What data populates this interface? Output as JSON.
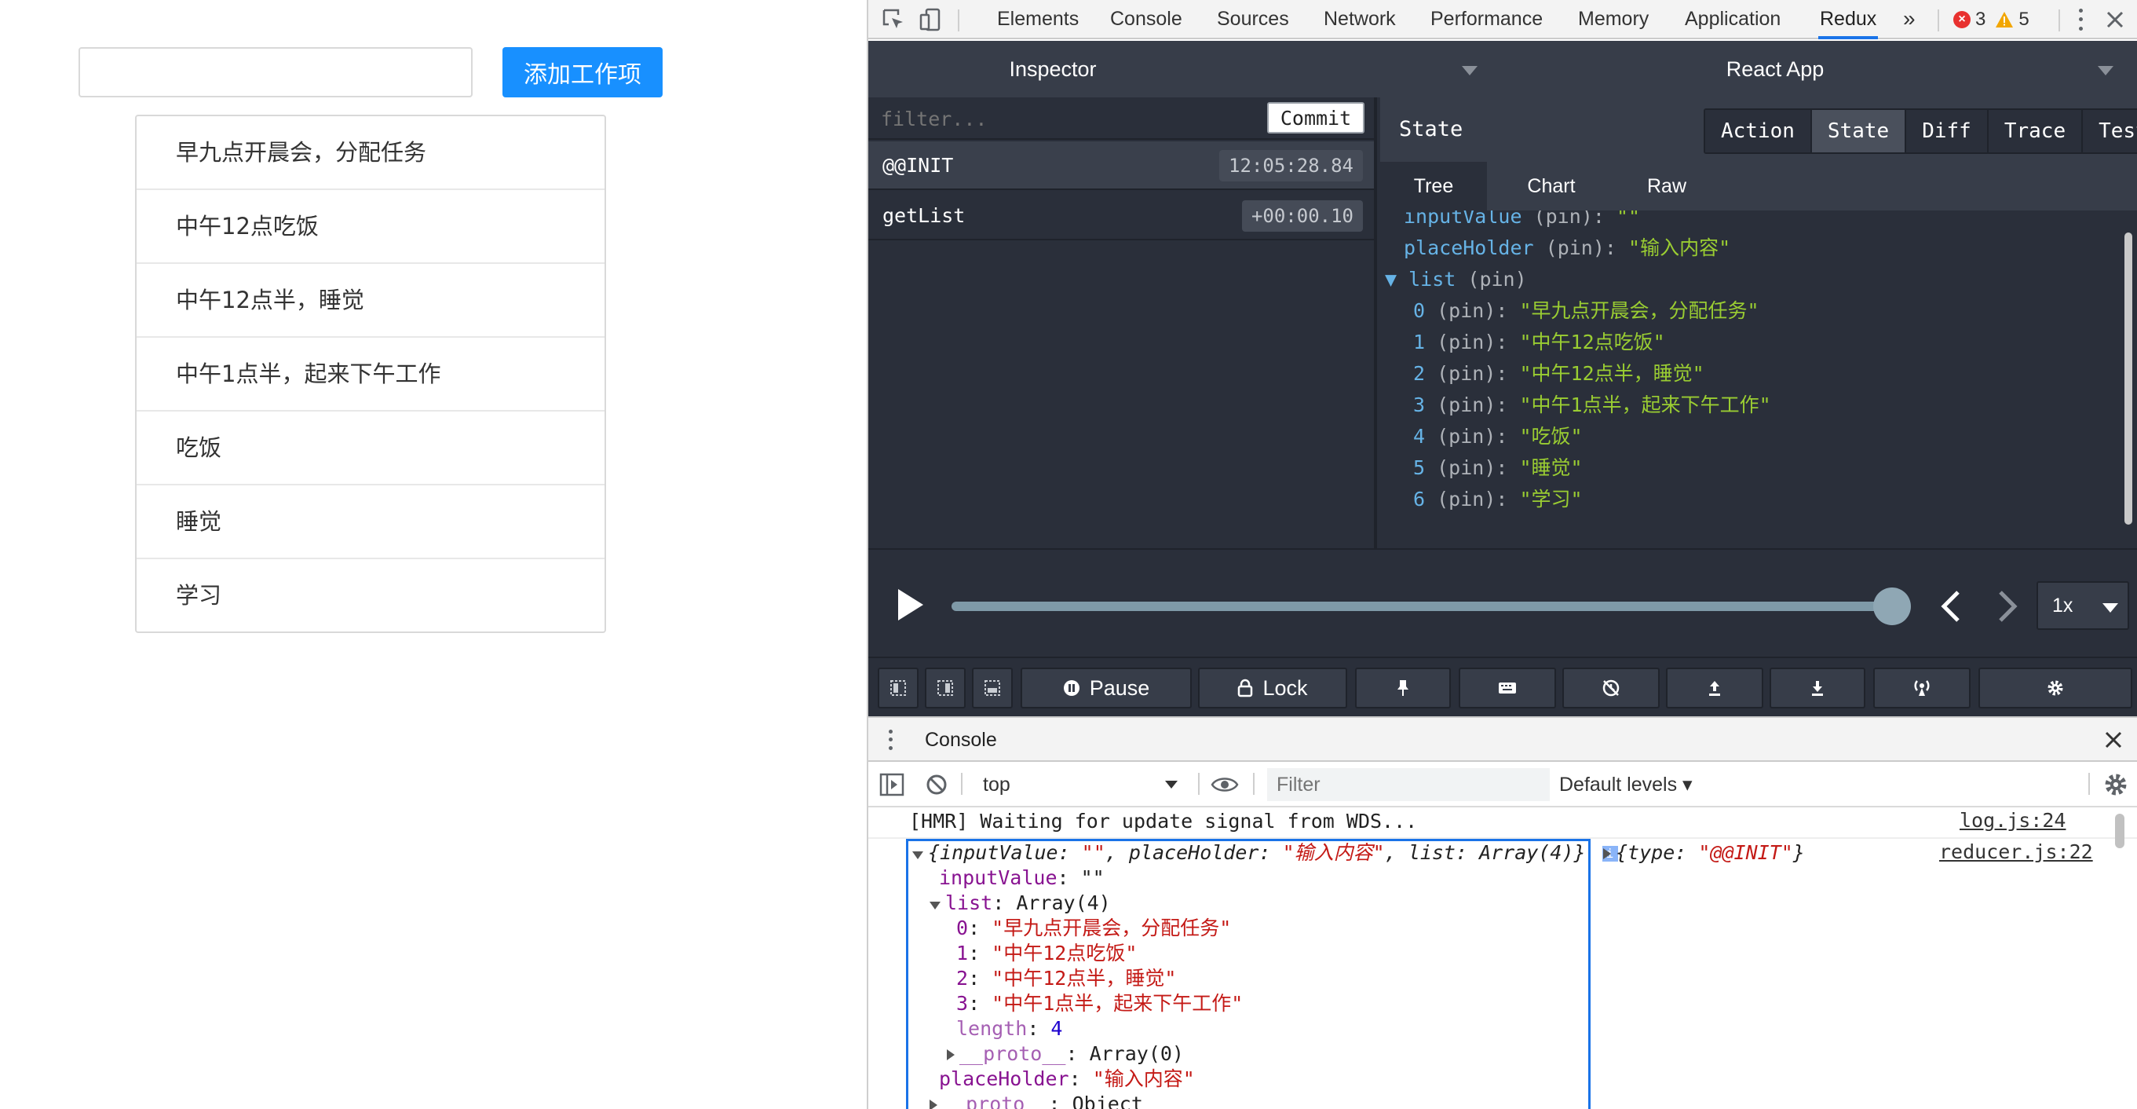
{
  "app": {
    "input_value": "",
    "add_button": "添加工作项",
    "items": [
      "早九点开晨会，分配任务",
      "中午12点吃饭",
      "中午12点半，睡觉",
      "中午1点半，起来下午工作",
      "吃饭",
      "睡觉",
      "学习"
    ]
  },
  "devtools": {
    "tabs": [
      "Elements",
      "Console",
      "Sources",
      "Network",
      "Performance",
      "Memory",
      "Application",
      "Redux"
    ],
    "active_tab": "Redux",
    "more_tabs": "»",
    "errors_count": "3",
    "warnings_count": "5",
    "redux": {
      "inspector_label": "Inspector",
      "instance_label": "React App",
      "filter_placeholder": "filter...",
      "commit_label": "Commit",
      "actions": [
        {
          "name": "@@INIT",
          "time": "12:05:28.84"
        },
        {
          "name": "getList",
          "time": "+00:00.10"
        }
      ],
      "state_label": "State",
      "modes": [
        "Action",
        "State",
        "Diff",
        "Trace",
        "Test"
      ],
      "active_mode": "State",
      "subtabs": [
        "Tree",
        "Chart",
        "Raw"
      ],
      "active_subtab": "Tree",
      "tree": {
        "input_value_key": "inputValue",
        "input_value_val": "\"\"",
        "placeholder_key": "placeHolder",
        "placeholder_val": "\"输入内容\"",
        "list_key": "list",
        "pin": "(pin)",
        "list_items": [
          "\"早九点开晨会，分配任务\"",
          "\"中午12点吃饭\"",
          "\"中午12点半，睡觉\"",
          "\"中午1点半，起来下午工作\"",
          "\"吃饭\"",
          "\"睡觉\"",
          "\"学习\""
        ]
      },
      "speed": "1x",
      "bottom_buttons": {
        "pause": "Pause",
        "lock": "Lock"
      },
      "slider_progress": 1.0
    },
    "console": {
      "tab_label": "Console",
      "context": "top",
      "filter_placeholder": "Filter",
      "levels": "Default levels ▾",
      "hmr_message": "[HMR] Waiting for update signal from WDS...",
      "log_link": "log.js:24",
      "reducer_link": "reducer.js:22",
      "obj_summary_prefix": "{inputValue: ",
      "obj_summary_ph": ", placeHolder: ",
      "obj_summary_ph_val": "\"输入内容\"",
      "obj_summary_list": ", list: Array(4)}",
      "empty_str": "\"\"",
      "input_value_key": "inputValue",
      "list_key": "list",
      "list_type": "Array(4)",
      "list_items": [
        "\"早九点开晨会，分配任务\"",
        "\"中午12点吃饭\"",
        "\"中午12点半，睡觉\"",
        "\"中午1点半，起来下午工作\""
      ],
      "length_key": "length",
      "length_val": "4",
      "proto_key": "__proto__",
      "proto_array": "Array(0)",
      "placeholder_key": "placeHolder",
      "placeholder_val": "\"输入内容\"",
      "proto_object": "Object",
      "action_summary_prefix": "{type: ",
      "action_type": "\"@@INIT\"",
      "action_summary_suffix": "}"
    }
  }
}
